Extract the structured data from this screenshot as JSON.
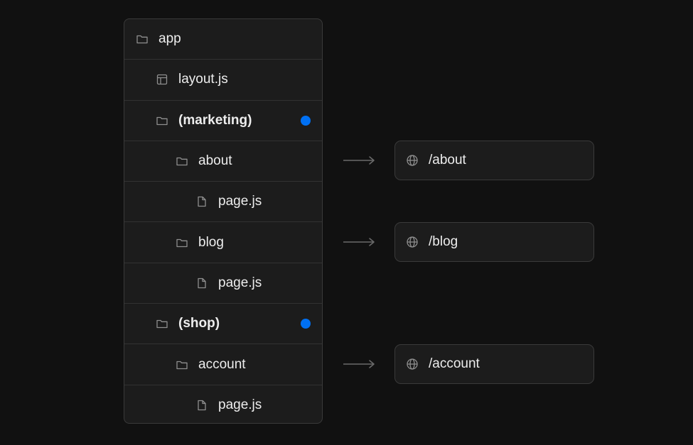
{
  "tree": {
    "rows": [
      {
        "label": "app",
        "icon": "folder-icon",
        "group": false
      },
      {
        "label": "layout.js",
        "icon": "layout-icon",
        "group": false
      },
      {
        "label": "(marketing)",
        "icon": "folder-icon",
        "group": true
      },
      {
        "label": "about",
        "icon": "folder-icon",
        "group": false
      },
      {
        "label": "page.js",
        "icon": "file-icon",
        "group": false
      },
      {
        "label": "blog",
        "icon": "folder-icon",
        "group": false
      },
      {
        "label": "page.js",
        "icon": "file-icon",
        "group": false
      },
      {
        "label": "(shop)",
        "icon": "folder-icon",
        "group": true
      },
      {
        "label": "account",
        "icon": "folder-icon",
        "group": false
      },
      {
        "label": "page.js",
        "icon": "file-icon",
        "group": false
      }
    ]
  },
  "routes": [
    {
      "path": "/about",
      "icon": "globe-icon"
    },
    {
      "path": "/blog",
      "icon": "globe-icon"
    },
    {
      "path": "/account",
      "icon": "globe-icon"
    }
  ],
  "colors": {
    "background": "#111111",
    "panel": "#1c1c1c",
    "border": "#3a3a3a",
    "text": "#ededed",
    "icon": "#8f8f8f",
    "arrow": "#6b6b6b",
    "group_dot": "#0070f3"
  }
}
